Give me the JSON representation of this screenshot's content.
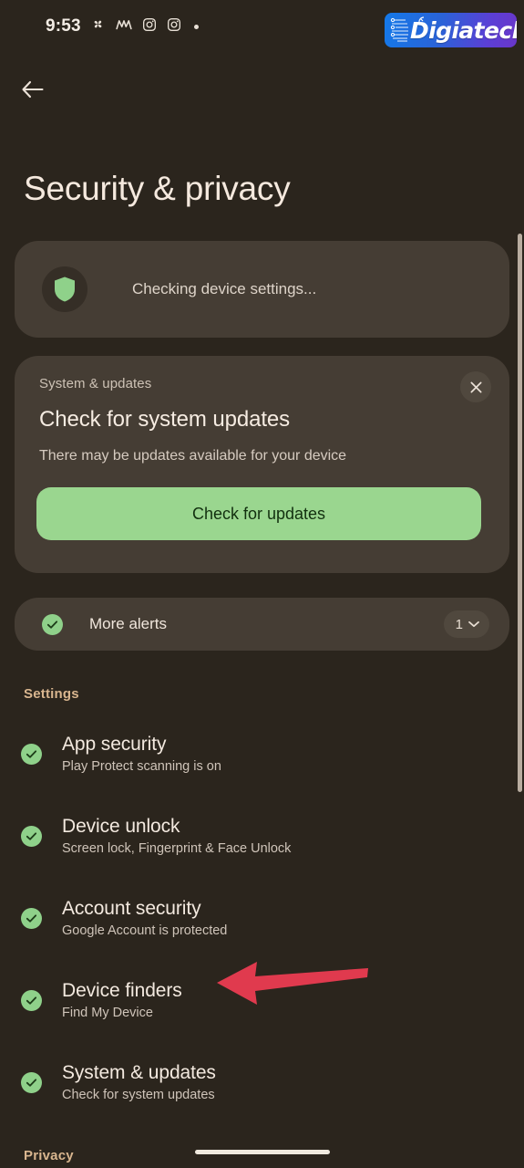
{
  "status_bar": {
    "time": "9:53",
    "icons": [
      "pinwheel-icon",
      "messenger-m-icon",
      "instagram-icon",
      "instagram-icon",
      "dot-indicator-icon"
    ]
  },
  "watermark": {
    "brand": "Digiatech",
    "brand_prefix": "D",
    "brand_rest": "igiatech",
    "gradient_start": "#1479e8",
    "gradient_end": "#6a36c9"
  },
  "nav": {
    "back_label": "Back"
  },
  "header": {
    "title": "Security & privacy"
  },
  "status_card": {
    "icon": "shield-icon",
    "text": "Checking device settings...",
    "shield_color": "#8fd18a"
  },
  "updates_card": {
    "eyebrow": "System & updates",
    "title": "Check for system updates",
    "subtitle": "There may be updates available for your device",
    "button_label": "Check for updates",
    "button_color": "#9ad68f",
    "close_label": "Dismiss"
  },
  "more_alerts": {
    "label": "More alerts",
    "count": "1",
    "chevron": "chevron-down-icon"
  },
  "sections": {
    "settings_label": "Settings",
    "privacy_label": "Privacy",
    "accent_color": "#d9b68f"
  },
  "settings_items": [
    {
      "title": "App security",
      "subtitle": "Play Protect scanning is on"
    },
    {
      "title": "Device unlock",
      "subtitle": "Screen lock, Fingerprint & Face Unlock"
    },
    {
      "title": "Account security",
      "subtitle": "Google Account is protected"
    },
    {
      "title": "Device finders",
      "subtitle": "Find My Device"
    },
    {
      "title": "System & updates",
      "subtitle": "Check for system updates"
    }
  ],
  "annotation": {
    "type": "arrow-left",
    "color": "#e03a4e",
    "points_to": "Device finders"
  },
  "theme": {
    "background": "#2b251d",
    "card": "#453d34",
    "text_primary": "#f3e9df",
    "text_secondary": "#cfc4b9",
    "check_green": "#8fd18a"
  }
}
